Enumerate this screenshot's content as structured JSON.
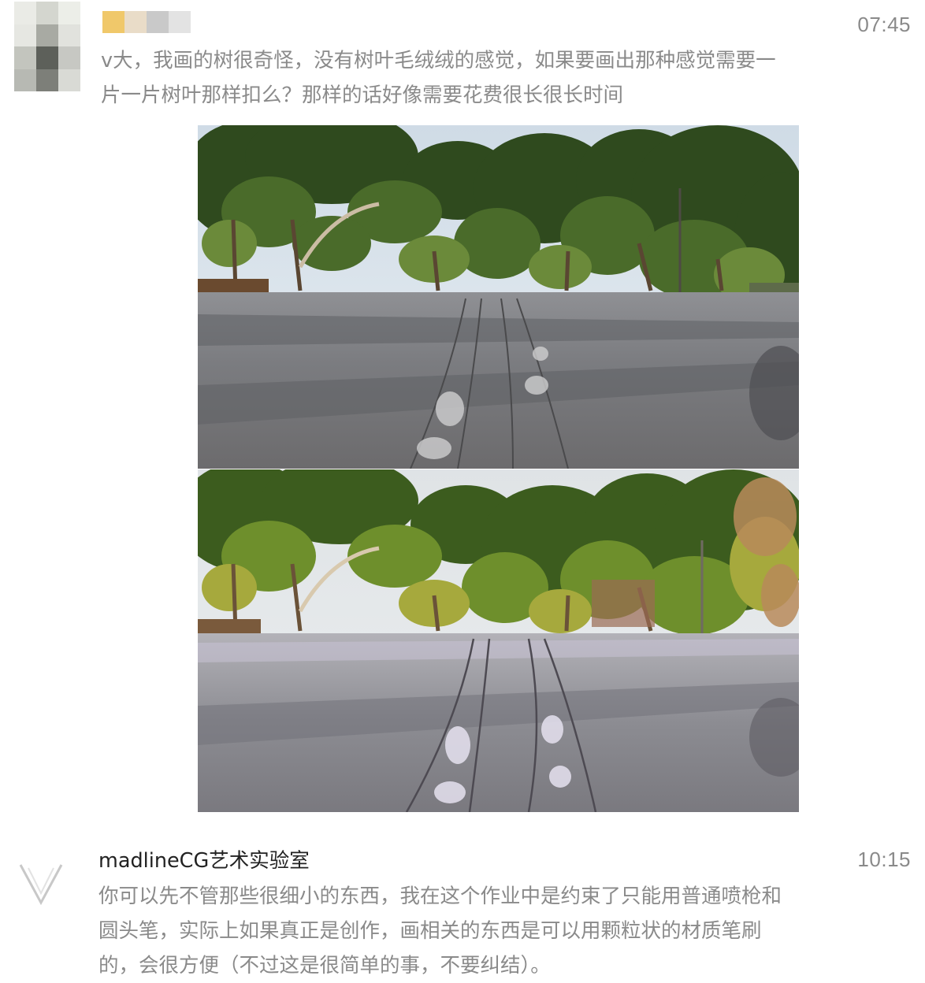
{
  "comments": [
    {
      "timestamp": "07:45",
      "lines": [
        "v大，我画的树很奇怪，没有树叶毛绒绒的感觉，如果要画出那种感觉需要一",
        "片一片树叶那样扣么？那样的话好像需要花费很长很长时间"
      ],
      "avatar_colors": [
        "#eaebe6",
        "#d4d6cf",
        "#eceee8",
        "#e6e7e2",
        "#a8aaa3",
        "#e1e2dd",
        "#c3c5be",
        "#5d605a",
        "#c7c8c3",
        "#b7b9b3",
        "#7d7f79",
        "#d9dad5"
      ],
      "name_mask_colors": [
        "#f0c86a",
        "#e9dcc8",
        "#c9c9c9",
        "#e3e3e3"
      ],
      "images": [
        "photo-park-road",
        "painting-park-road"
      ]
    },
    {
      "username": "madlineCG艺术实验室",
      "timestamp": "10:15",
      "lines": [
        "你可以先不管那些很细小的东西，我在这个作业中是约束了只能用普通喷枪和",
        "圆头笔，实际上如果真正是创作，画相关的东西是可以用颗粒状的材质笔刷",
        "的，会很方便（不过这是很简单的事，不要纠结）。"
      ]
    }
  ],
  "colors": {
    "text_gray": "#8a8a8a",
    "username": "#222222",
    "background": "#ffffff"
  }
}
